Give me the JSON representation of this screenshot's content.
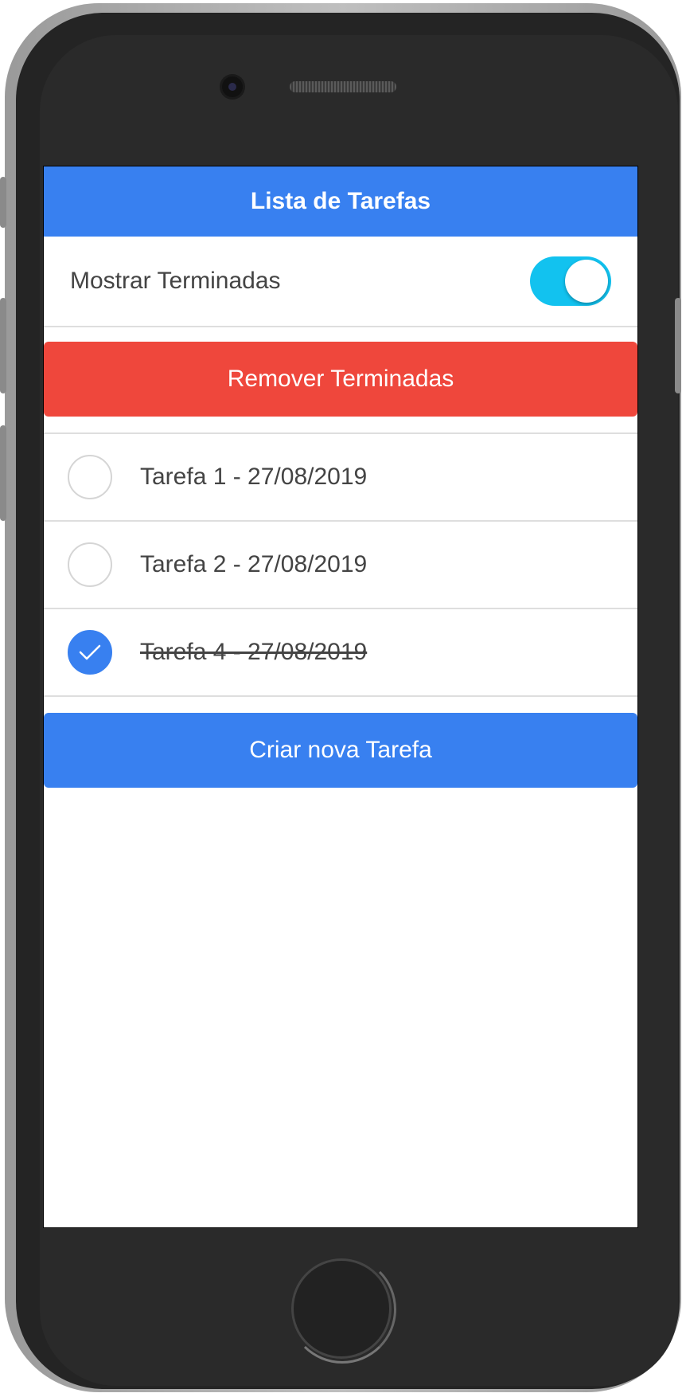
{
  "app": {
    "title": "Lista de Tarefas"
  },
  "options": {
    "show_done_label": "Mostrar Terminadas",
    "show_done_on": true
  },
  "actions": {
    "remove_done_label": "Remover Terminadas",
    "create_label": "Criar nova Tarefa"
  },
  "tasks": [
    {
      "label": "Tarefa 1 - 27/08/2019",
      "done": false
    },
    {
      "label": "Tarefa 2 - 27/08/2019",
      "done": false
    },
    {
      "label": "Tarefa 4 - 27/08/2019",
      "done": true
    }
  ],
  "colors": {
    "primary": "#3880f0",
    "danger": "#ef473c",
    "toggle_on": "#12c2ef"
  },
  "icons": {
    "check": "checkmark-icon"
  }
}
